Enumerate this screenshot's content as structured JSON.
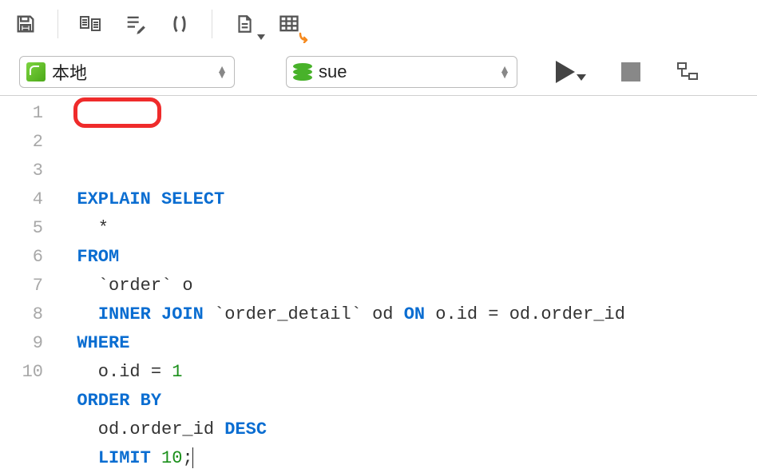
{
  "toolbar": {
    "icons": [
      "save",
      "copy-doc",
      "edit-list",
      "parentheses",
      "document",
      "table-export"
    ]
  },
  "connection": {
    "label": "本地"
  },
  "database": {
    "label": "sue"
  },
  "code": {
    "lines": [
      {
        "indent": 0,
        "tokens": [
          [
            "kw",
            "EXPLAIN"
          ],
          [
            "sp",
            " "
          ],
          [
            "kw",
            "SELECT"
          ]
        ]
      },
      {
        "indent": 1,
        "tokens": [
          [
            "t",
            "*"
          ]
        ]
      },
      {
        "indent": 0,
        "tokens": [
          [
            "kw",
            "FROM"
          ]
        ]
      },
      {
        "indent": 1,
        "tokens": [
          [
            "t",
            "`order` o"
          ]
        ]
      },
      {
        "indent": 1,
        "tokens": [
          [
            "kw",
            "INNER JOIN"
          ],
          [
            "t",
            " `order_detail` od "
          ],
          [
            "kw",
            "ON"
          ],
          [
            "t",
            " o.id = od.order_id"
          ]
        ]
      },
      {
        "indent": 0,
        "tokens": [
          [
            "kw",
            "WHERE"
          ]
        ]
      },
      {
        "indent": 1,
        "tokens": [
          [
            "t",
            "o.id = "
          ],
          [
            "num",
            "1"
          ]
        ]
      },
      {
        "indent": 0,
        "tokens": [
          [
            "kw",
            "ORDER BY"
          ]
        ]
      },
      {
        "indent": 1,
        "tokens": [
          [
            "t",
            "od.order_id "
          ],
          [
            "kw",
            "DESC"
          ]
        ]
      },
      {
        "indent": 1,
        "tokens": [
          [
            "kw",
            "LIMIT"
          ],
          [
            "t",
            " "
          ],
          [
            "num",
            "10"
          ],
          [
            "t",
            ";"
          ]
        ]
      }
    ]
  },
  "highlight": {
    "line": 1,
    "word": "EXPLAIN"
  }
}
